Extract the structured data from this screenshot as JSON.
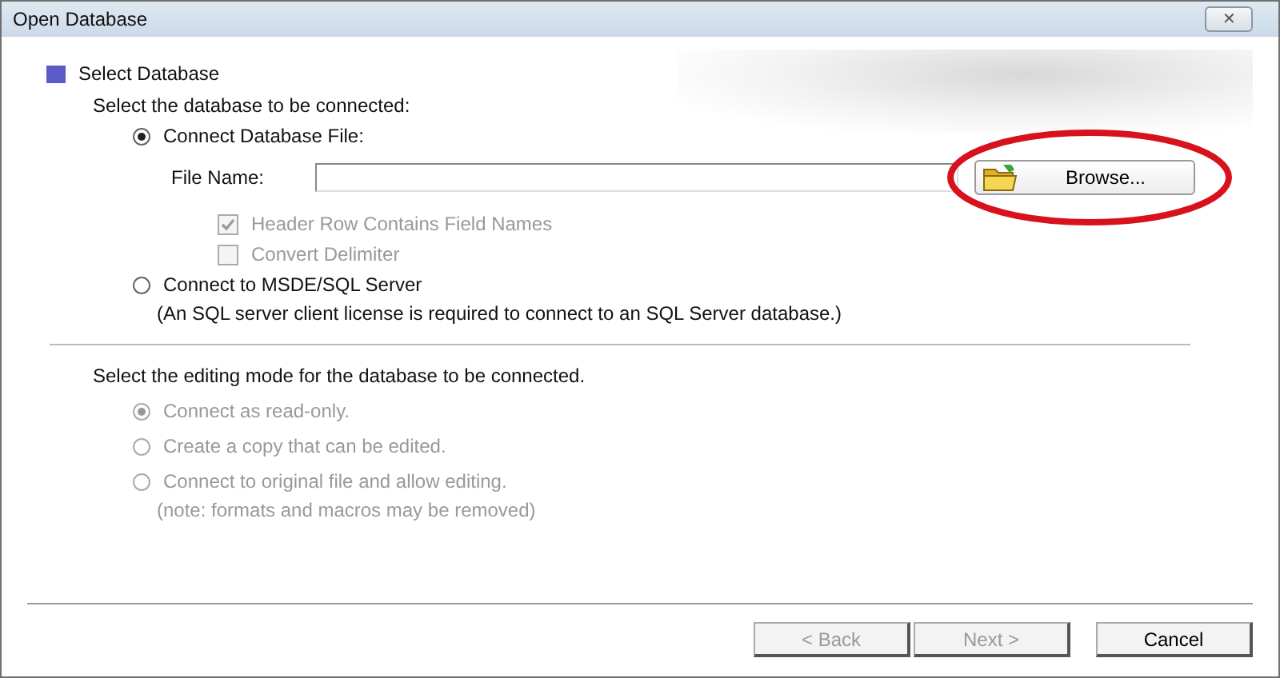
{
  "window": {
    "title": "Open Database",
    "close_label": "✕"
  },
  "section": {
    "title": "Select Database"
  },
  "database": {
    "prompt": "Select the database to be connected:",
    "options": [
      {
        "label": "Connect Database File:",
        "selected": true,
        "kind": "file"
      },
      {
        "label": "Connect to MSDE/SQL Server",
        "selected": false,
        "kind": "server",
        "note": "(An SQL server client license is required to connect to an SQL Server database.)"
      }
    ],
    "file_field": {
      "label": "File Name:"
    },
    "browse_button": {
      "label": "Browse..."
    },
    "checkboxes": [
      {
        "label": "Header Row Contains Field Names",
        "checked": true,
        "disabled": true
      },
      {
        "label": "Convert Delimiter",
        "checked": false,
        "disabled": true
      }
    ]
  },
  "editing": {
    "prompt": "Select the editing mode for the database to be connected.",
    "options": [
      {
        "label": "Connect as read-only.",
        "selected": true,
        "disabled": true
      },
      {
        "label": "Create a copy that can be edited.",
        "selected": false,
        "disabled": true
      },
      {
        "label": "Connect to original file and allow editing.",
        "selected": false,
        "disabled": true,
        "note": "(note:  formats and macros may be removed)"
      }
    ]
  },
  "buttons": [
    {
      "label": "< Back",
      "disabled": true
    },
    {
      "label": "Next >",
      "disabled": true
    },
    {
      "label": "Cancel",
      "disabled": false
    }
  ]
}
